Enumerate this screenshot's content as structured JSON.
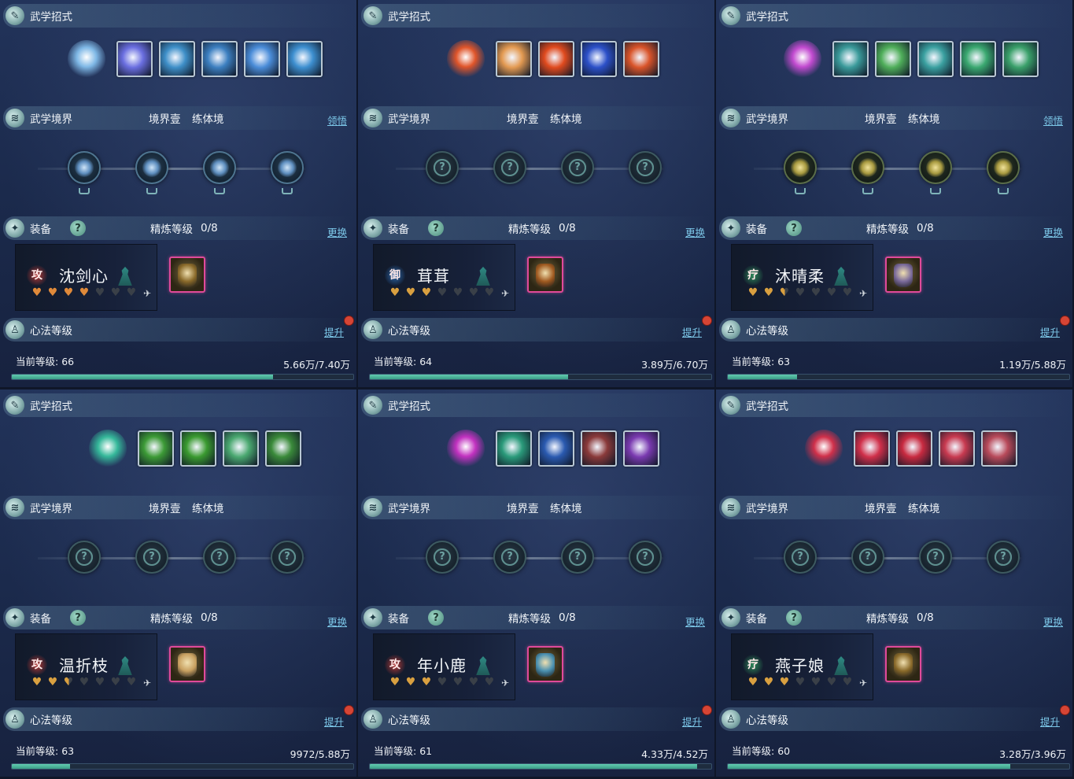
{
  "labels": {
    "skills_header": "武学招式",
    "realm_header": "武学境界",
    "realm_stage": "境界壹",
    "realm_name": "练体境",
    "comprehend": "领悟",
    "equip_header": "装备",
    "refine_label": "精炼等级",
    "replace": "更换",
    "mind_header": "心法等级",
    "upgrade": "提升",
    "current_level_label": "当前等级:",
    "help": "?"
  },
  "panels": [
    {
      "id": "p1",
      "has_comprehend": true,
      "realm_nodes_unlocked": true,
      "node_style": "blue",
      "main_skill_color": "#7fb8e6",
      "skill_colors": [
        "#6a6ee0",
        "#3e8fc8",
        "#3c7fc0",
        "#4a8cd8",
        "#3d8fd0"
      ],
      "skill_count": 5,
      "refine": "0/8",
      "char_badge": "攻",
      "badge_color": "#b83a36",
      "char_name": "沈剑心",
      "hearts": [
        "full",
        "full",
        "full",
        "full",
        "empty",
        "empty",
        "empty"
      ],
      "heart_color": "#e08a3a",
      "equip_color": "#8a6a2a",
      "level": "66",
      "progress": "5.66万/7.40万",
      "progress_ratio": 0.765
    },
    {
      "id": "p2",
      "has_comprehend": false,
      "realm_nodes_unlocked": false,
      "node_style": "locked",
      "main_skill_color": "#e0552a",
      "skill_colors": [
        "#e39a52",
        "#e04a1e",
        "#2c50c8",
        "#d9542a"
      ],
      "skill_count": 4,
      "refine": "0/8",
      "char_badge": "御",
      "badge_color": "#2c6ab0",
      "char_name": "茸茸",
      "hearts": [
        "full",
        "full",
        "full",
        "empty",
        "empty",
        "empty",
        "empty"
      ],
      "heart_color": "#d9a040",
      "equip_color": "#a05a20",
      "level": "64",
      "progress": "3.89万/6.70万",
      "progress_ratio": 0.581
    },
    {
      "id": "p3",
      "has_comprehend": true,
      "realm_nodes_unlocked": true,
      "node_style": "gold",
      "main_skill_color": "#c24bd0",
      "skill_colors": [
        "#3a9a9a",
        "#4fae5a",
        "#3aa0a0",
        "#3aa870",
        "#3aa06a"
      ],
      "skill_count": 5,
      "refine": "0/8",
      "char_badge": "疗",
      "badge_color": "#2e8a5a",
      "char_name": "沐晴柔",
      "hearts": [
        "full",
        "full",
        "half",
        "empty",
        "empty",
        "empty",
        "empty"
      ],
      "heart_color": "#d9a040",
      "equip_color": "#7a6a9a",
      "level": "63",
      "progress": "1.19万/5.88万",
      "progress_ratio": 0.202
    },
    {
      "id": "p4",
      "has_comprehend": false,
      "realm_nodes_unlocked": false,
      "node_style": "locked",
      "main_skill_color": "#35b89a",
      "skill_colors": [
        "#3c9a36",
        "#3a9a30",
        "#4aa870",
        "#3a8a3a"
      ],
      "skill_count": 4,
      "refine": "0/8",
      "char_badge": "攻",
      "badge_color": "#b83a36",
      "char_name": "温折枝",
      "hearts": [
        "full",
        "full",
        "half",
        "empty",
        "empty",
        "empty",
        "empty"
      ],
      "heart_color": "#d9a040",
      "equip_color": "#c8a060",
      "level": "63",
      "progress": "9972/5.88万",
      "progress_ratio": 0.17
    },
    {
      "id": "p5",
      "has_comprehend": false,
      "realm_nodes_unlocked": false,
      "node_style": "locked",
      "main_skill_color": "#c232c0",
      "skill_colors": [
        "#2a9a7a",
        "#2a5ab0",
        "#8a3a3a",
        "#7a3ab0"
      ],
      "skill_count": 4,
      "refine": "0/8",
      "char_badge": "攻",
      "badge_color": "#b83a36",
      "char_name": "年小鹿",
      "hearts": [
        "full",
        "full",
        "full",
        "empty",
        "empty",
        "empty",
        "empty"
      ],
      "heart_color": "#d9a040",
      "equip_color": "#4a90b0",
      "level": "61",
      "progress": "4.33万/4.52万",
      "progress_ratio": 0.958
    },
    {
      "id": "p6",
      "has_comprehend": false,
      "realm_nodes_unlocked": false,
      "node_style": "locked",
      "main_skill_color": "#d0304a",
      "skill_colors": [
        "#d0304a",
        "#c82a40",
        "#c83a50",
        "#b84a5a"
      ],
      "skill_count": 4,
      "refine": "0/8",
      "char_badge": "疗",
      "badge_color": "#2e8a5a",
      "char_name": "燕子娘",
      "hearts": [
        "full",
        "full",
        "full",
        "empty",
        "empty",
        "empty",
        "empty"
      ],
      "heart_color": "#d9a040",
      "equip_color": "#8a6a2a",
      "level": "60",
      "progress": "3.28万/3.96万",
      "progress_ratio": 0.828
    }
  ]
}
